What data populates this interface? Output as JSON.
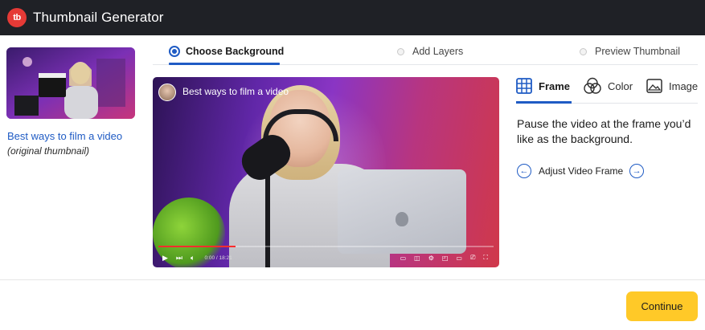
{
  "header": {
    "logo_text": "tb",
    "title": "Thumbnail Generator",
    "bg_color": "#1f2126",
    "logo_color": "#e53a36"
  },
  "left": {
    "video_title": "Best ways to film a video",
    "subtitle": "(original thumbnail)"
  },
  "steps": [
    {
      "label": "Choose Background",
      "active": true
    },
    {
      "label": "Add Layers",
      "active": false
    },
    {
      "label": "Preview Thumbnail",
      "active": false
    }
  ],
  "video": {
    "title": "Best ways to film a video",
    "time": "0:00 / 18:21",
    "progress": 0.23
  },
  "panel": {
    "tabs": [
      {
        "label": "Frame",
        "icon": "frame-grid-icon",
        "active": true
      },
      {
        "label": "Color",
        "icon": "color-circles-icon",
        "active": false
      },
      {
        "label": "Image",
        "icon": "image-icon",
        "active": false
      }
    ],
    "instructions": "Pause the video at the frame you’d like as the background.",
    "adjust_label": "Adjust Video Frame"
  },
  "footer": {
    "continue_label": "Continue",
    "accent": "#ffc928"
  },
  "colors": {
    "primary": "#1f5bc4"
  }
}
